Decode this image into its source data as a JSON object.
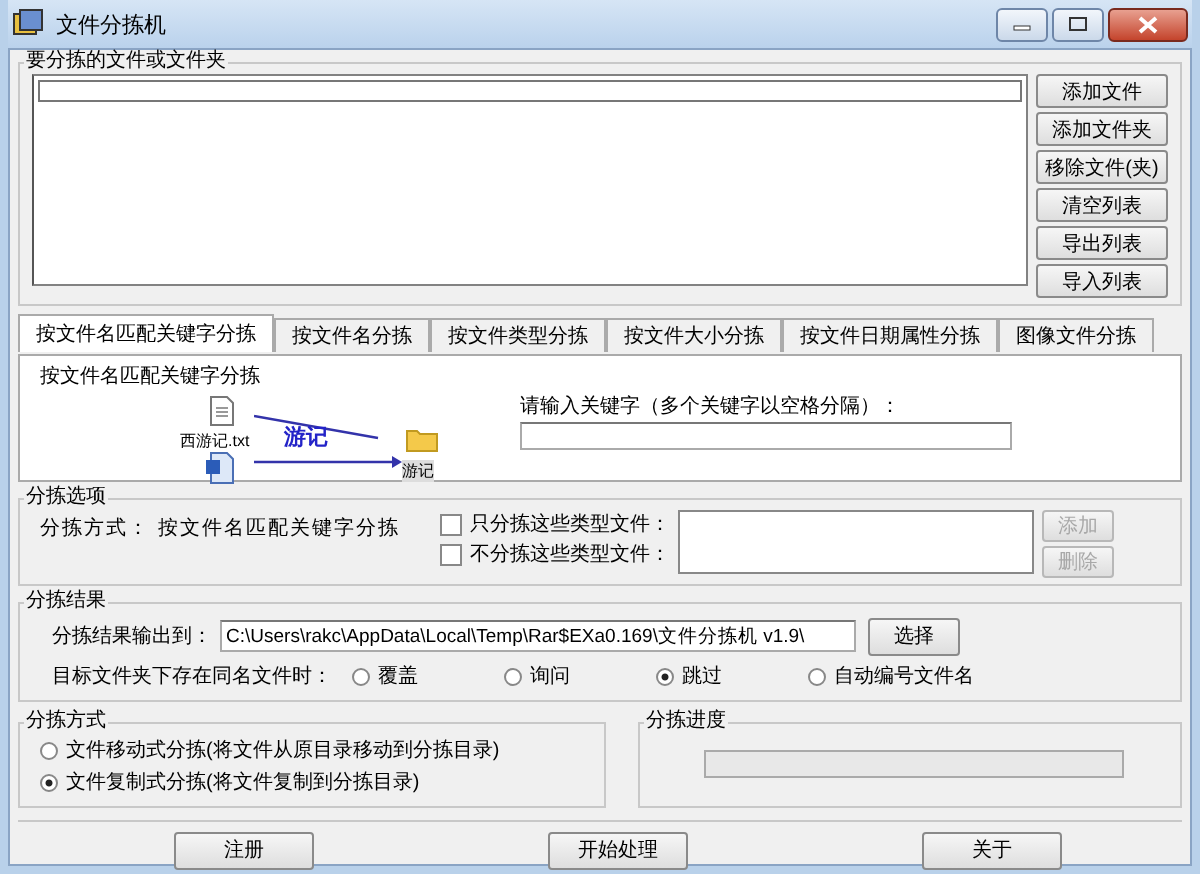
{
  "window": {
    "title": "文件分拣机"
  },
  "file_list": {
    "label": "要分拣的文件或文件夹",
    "buttons": [
      {
        "label": "添加文件"
      },
      {
        "label": "添加文件夹"
      },
      {
        "label": "移除文件(夹)"
      },
      {
        "label": "清空列表"
      },
      {
        "label": "导出列表"
      },
      {
        "label": "导入列表"
      }
    ]
  },
  "tabs": [
    {
      "label": "按文件名匹配关键字分拣",
      "selected": true
    },
    {
      "label": "按文件名分拣",
      "selected": false
    },
    {
      "label": "按文件类型分拣",
      "selected": false
    },
    {
      "label": "按文件大小分拣",
      "selected": false
    },
    {
      "label": "按文件日期属性分拣",
      "selected": false
    },
    {
      "label": "图像文件分拣",
      "selected": false
    }
  ],
  "tab_panel": {
    "title": "按文件名匹配关键字分拣",
    "example": {
      "file_label": "西游记.txt",
      "keyword": "游记",
      "folder_label": "游记"
    },
    "keyword_field": {
      "label": "请输入关键字（多个关键字以空格分隔）："
    }
  },
  "options": {
    "label": "分拣选项",
    "method_label": "分拣方式：",
    "method_value": "按文件名匹配关键字分拣",
    "filters": [
      {
        "label": "只分拣这些类型文件：",
        "checked": false
      },
      {
        "label": "不分拣这些类型文件：",
        "checked": false
      }
    ],
    "buttons": [
      {
        "label": "添加",
        "disabled": true
      },
      {
        "label": "删除",
        "disabled": true
      }
    ]
  },
  "result": {
    "label": "分拣结果",
    "output_label": "分拣结果输出到：",
    "output_path": "C:\\Users\\rakc\\AppData\\Local\\Temp\\Rar$EXa0.169\\文件分拣机 v1.9\\",
    "browse_button": "选择",
    "conflict_label": "目标文件夹下存在同名文件时：",
    "conflict_options": [
      {
        "label": "覆盖",
        "selected": false
      },
      {
        "label": "询问",
        "selected": false
      },
      {
        "label": "跳过",
        "selected": true
      },
      {
        "label": "自动编号文件名",
        "selected": false
      }
    ]
  },
  "mode": {
    "label": "分拣方式",
    "options": [
      {
        "label": "文件移动式分拣(将文件从原目录移动到分拣目录)",
        "selected": false
      },
      {
        "label": "文件复制式分拣(将文件复制到分拣目录)",
        "selected": true
      }
    ]
  },
  "progress": {
    "label": "分拣进度",
    "level": 0
  },
  "footer_buttons": [
    "注册",
    "开始处理",
    "关于"
  ]
}
